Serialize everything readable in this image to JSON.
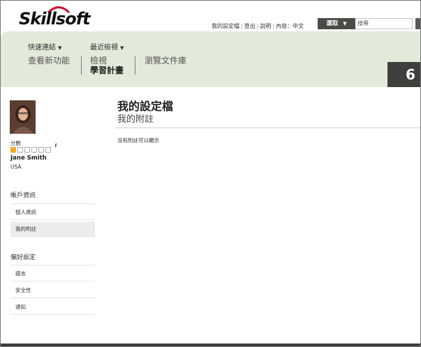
{
  "header": {
    "logo_text": "Skillsoft",
    "links": [
      "我的設定檔",
      "登出",
      "說明",
      "內容：中文"
    ],
    "select_label": "選取",
    "search_placeholder": "搜尋"
  },
  "nav": {
    "quick_links_label": "快速連結",
    "recent_label": "最近檢視",
    "whats_new": "查看新功能",
    "view_label": "檢視",
    "learning_plan": "學習計畫",
    "browse_library": "瀏覽文件庫",
    "tab_number": "6"
  },
  "profile": {
    "score_label": "分數",
    "score_level": 1,
    "score_max": 6,
    "name": "Jane Smith",
    "country": "USA"
  },
  "sidebar": {
    "account_title": "帳戶資訊",
    "account_items": [
      "個人資訊",
      "我的附註"
    ],
    "prefs_title": "偏好設定",
    "prefs_items": [
      "語言",
      "安全性",
      "通知"
    ]
  },
  "main": {
    "title": "我的設定檔",
    "subtitle": "我的附註",
    "empty_message": "沒有附註可以顯示"
  },
  "colors": {
    "nav_band": "#e2eada",
    "score_fill": "#f0b01e",
    "dark": "#3f3f3c"
  }
}
